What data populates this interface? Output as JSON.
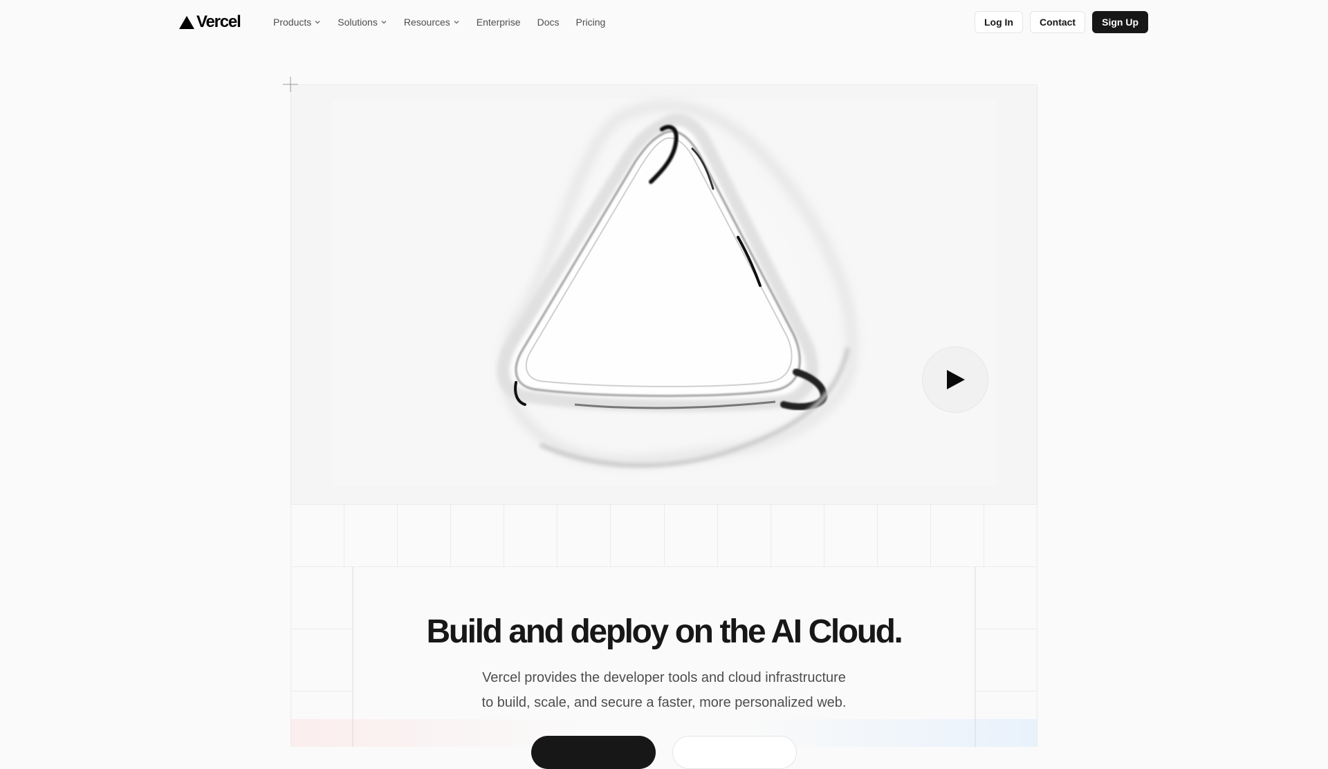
{
  "brand": {
    "name": "Vercel",
    "logo_icon": "triangle-logo-icon"
  },
  "nav": {
    "items": [
      {
        "label": "Products",
        "has_dropdown": true
      },
      {
        "label": "Solutions",
        "has_dropdown": true
      },
      {
        "label": "Resources",
        "has_dropdown": true
      },
      {
        "label": "Enterprise",
        "has_dropdown": false
      },
      {
        "label": "Docs",
        "has_dropdown": false
      },
      {
        "label": "Pricing",
        "has_dropdown": false
      }
    ],
    "login_label": "Log In",
    "contact_label": "Contact",
    "signup_label": "Sign Up"
  },
  "video": {
    "play_icon": "play-icon"
  },
  "hero": {
    "title": "Build and deploy on the AI Cloud.",
    "subtitle_line1": "Vercel provides the developer tools and cloud infrastructure",
    "subtitle_line2": "to build, scale, and secure a faster, more personalized web."
  },
  "colors": {
    "background": "#fafafa",
    "text": "#171717",
    "muted": "#4d4d4d",
    "border": "#ebebeb",
    "primary_button": "#171717"
  }
}
